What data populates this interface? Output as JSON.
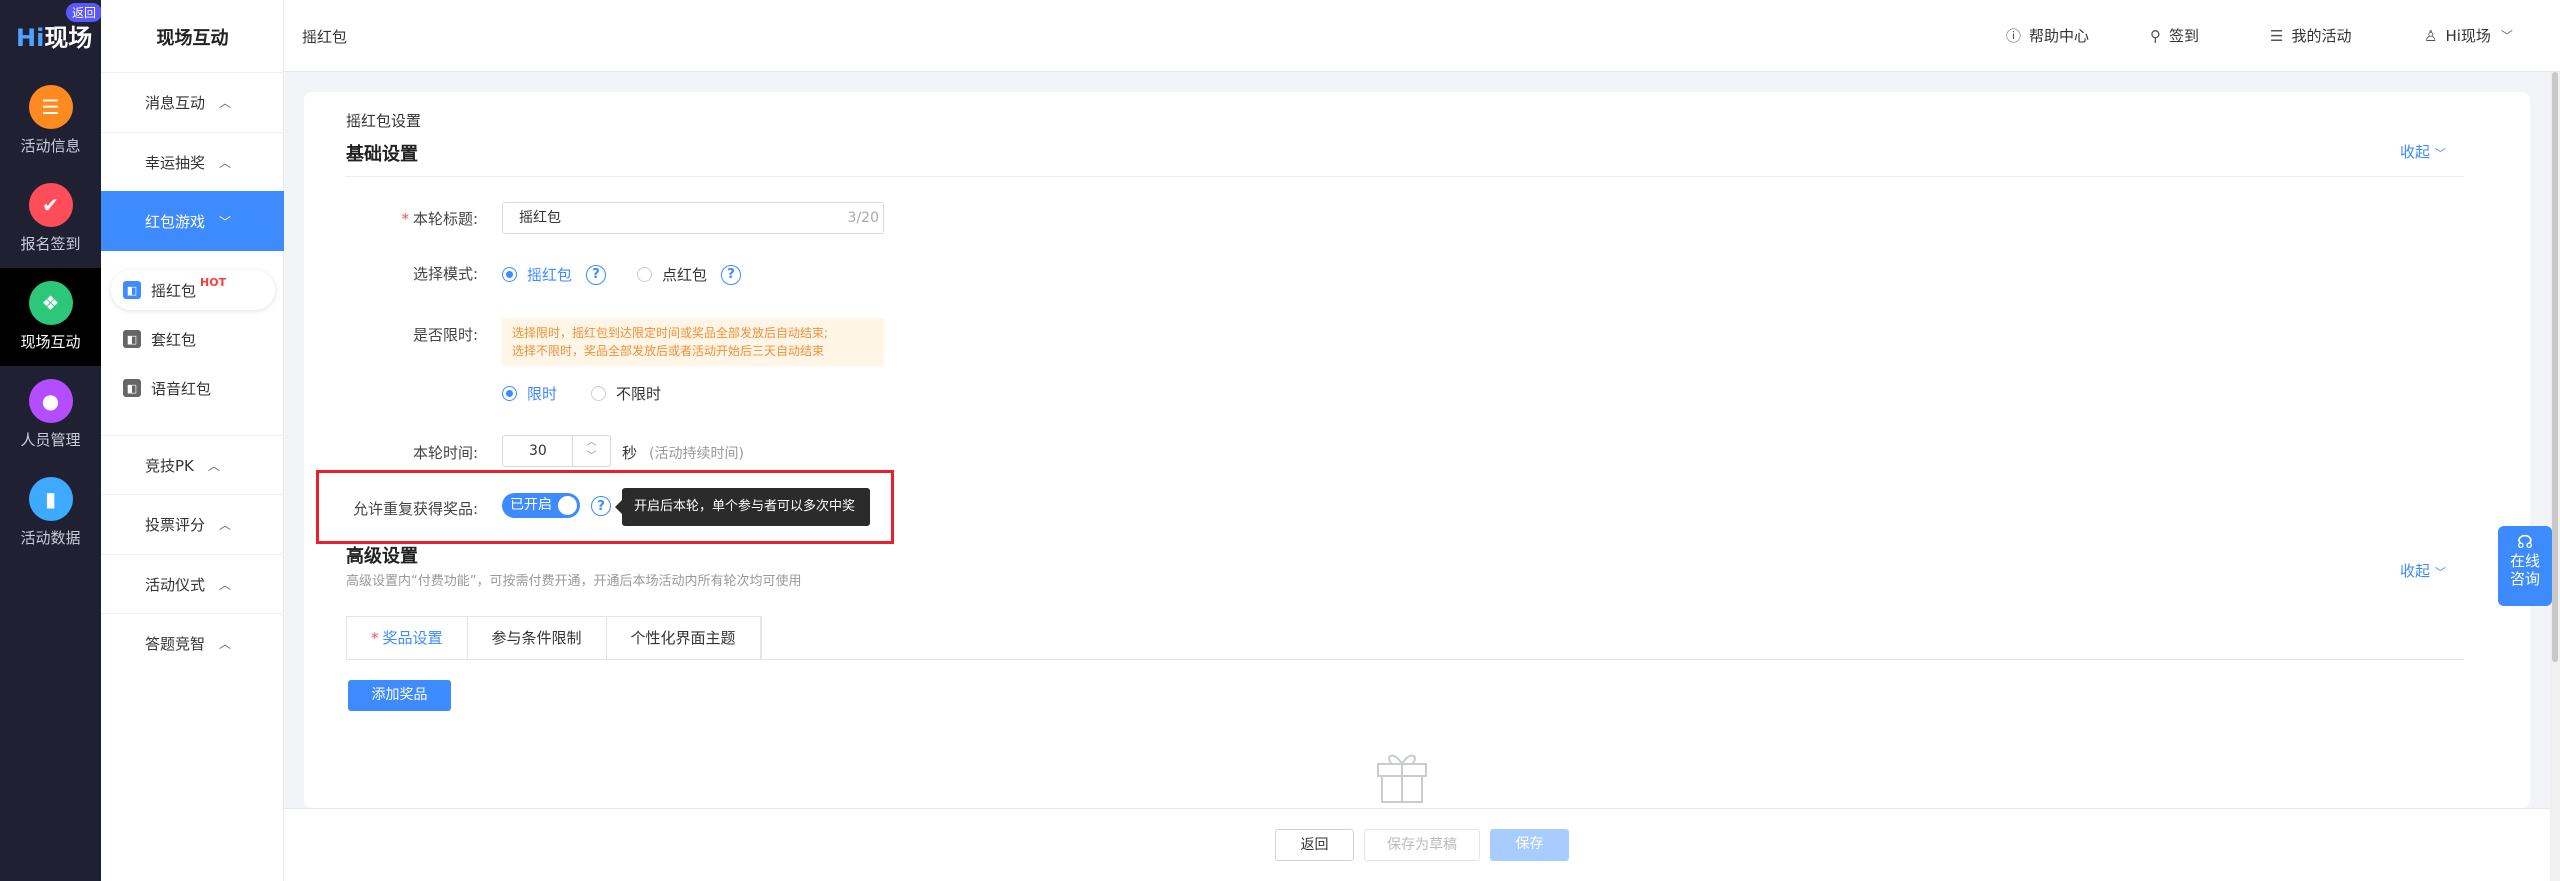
{
  "rail": {
    "logo_hi": "Hi",
    "logo_text": "现场",
    "back_badge": "返回",
    "items": [
      {
        "label": "活动信息",
        "icon": "doc-icon",
        "color": "#ff8a1f"
      },
      {
        "label": "报名签到",
        "icon": "clipboard-icon",
        "color": "#ff4d5a"
      },
      {
        "label": "现场互动",
        "icon": "interaction-icon",
        "color": "#2dc77a"
      },
      {
        "label": "人员管理",
        "icon": "person-icon",
        "color": "#b44dff"
      },
      {
        "label": "活动数据",
        "icon": "chart-icon",
        "color": "#3daaff"
      }
    ]
  },
  "menu": {
    "title": "现场互动",
    "groups": {
      "g1": "消息互动",
      "g2": "幸运抽奖",
      "g3": "红包游戏",
      "g4": "竞技PK",
      "g5": "投票评分",
      "g6": "活动仪式",
      "g7": "答题竞智"
    },
    "sub": {
      "s1": "摇红包",
      "s1_badge": "HOT",
      "s2": "套红包",
      "s3": "语音红包"
    }
  },
  "header": {
    "breadcrumb": "摇红包",
    "help": "帮助中心",
    "signin": "签到",
    "my_activities": "我的活动",
    "user": "Hi现场"
  },
  "page": {
    "small_title": "摇红包设置",
    "basic_title": "基础设置",
    "collapse": "收起",
    "round_title_label": "本轮标题:",
    "round_title_value": "摇红包",
    "round_title_count": "3/20",
    "mode_label": "选择模式:",
    "mode_shake": "摇红包",
    "mode_tap": "点红包",
    "limit_label": "是否限时:",
    "limit_warn_1": "选择限时，摇红包到达限定时间或奖品全部发放后自动结束;",
    "limit_warn_2": "选择不限时，奖品全部发放后或者活动开始后三天自动结束",
    "limit_yes": "限时",
    "limit_no": "不限时",
    "time_label": "本轮时间:",
    "time_value": "30",
    "time_unit": "秒",
    "time_hint": "(活动持续时间)",
    "repeat_label": "允许重复获得奖品:",
    "repeat_switch": "已开启",
    "repeat_tooltip": "开启后本轮，单个参与者可以多次中奖",
    "advanced_title": "高级设置",
    "advanced_note": "高级设置内“付费功能”，可按需付费开通，开通后本场活动内所有轮次均可使用",
    "tabs": [
      "奖品设置",
      "参与条件限制",
      "个性化界面主题"
    ],
    "add_prize": "添加奖品"
  },
  "online": {
    "line1": "在线",
    "line2": "咨询"
  },
  "footer": {
    "back": "返回",
    "draft": "保存为草稿",
    "save": "保存"
  },
  "colors": {
    "accent": "#3d8bff",
    "rail_bg": "#1f2133",
    "highlight": "#e8202a"
  }
}
